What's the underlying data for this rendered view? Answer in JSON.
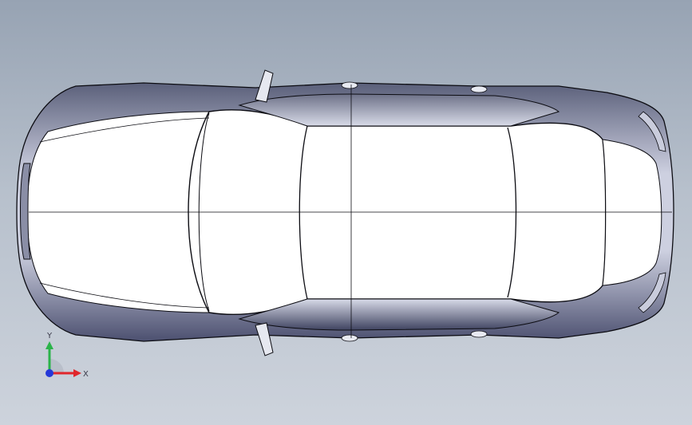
{
  "viewport": {
    "background_top": "#97a3b3",
    "background_bottom": "#cdd3dc"
  },
  "model": {
    "view": "top",
    "edge_color": "#0c0c12",
    "face_color": "#ffffff",
    "shade_color": "#6a6f8a"
  },
  "triad": {
    "x_label": "X",
    "y_label": "Y",
    "x_color": "#e0262b",
    "y_color": "#2bb34a",
    "z_color": "#2438d8"
  }
}
